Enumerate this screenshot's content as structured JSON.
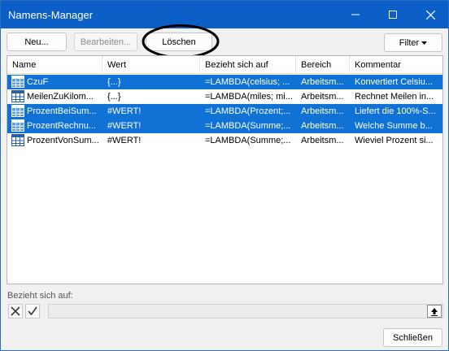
{
  "window": {
    "title": "Namens-Manager"
  },
  "toolbar": {
    "new_label": "Neu...",
    "edit_label": "Bearbeiten...",
    "delete_label": "Löschen",
    "filter_label": "Filter"
  },
  "table": {
    "columns": [
      "Name",
      "Wert",
      "Bezieht sich auf",
      "Bereich",
      "Kommentar"
    ],
    "rows": [
      {
        "name": "CzuF",
        "wert": "{...}",
        "bezieht": "=LAMBDA(celsius; ...",
        "bereich": "Arbeitsm...",
        "kommentar": "Konvertiert Celsiu...",
        "selected": true
      },
      {
        "name": "MeilenZuKilom...",
        "wert": "{...}",
        "bezieht": "=LAMBDA(miles; mi...",
        "bereich": "Arbeitsm...",
        "kommentar": "Rechnet Meilen in...",
        "selected": false
      },
      {
        "name": "ProzentBeiSum...",
        "wert": "#WERT!",
        "bezieht": "=LAMBDA(Prozent;...",
        "bereich": "Arbeitsm...",
        "kommentar": "Liefert die 100%-S...",
        "selected": true
      },
      {
        "name": "ProzentRechnu...",
        "wert": "#WERT!",
        "bezieht": "=LAMBDA(Summe;...",
        "bereich": "Arbeitsm...",
        "kommentar": "Welche Summe b...",
        "selected": true
      },
      {
        "name": "ProzentVonSum...",
        "wert": "#WERT!",
        "bezieht": "=LAMBDA(Summe;...",
        "bereich": "Arbeitsm...",
        "kommentar": "Wieviel Prozent si...",
        "selected": false
      }
    ]
  },
  "refers_to": {
    "label": "Bezieht sich auf:",
    "value": ""
  },
  "footer": {
    "close_label": "Schließen"
  },
  "colors": {
    "titlebar": "#0b5fc7",
    "selection": "#0f72d4",
    "annotation_ellipse": "#000000"
  }
}
